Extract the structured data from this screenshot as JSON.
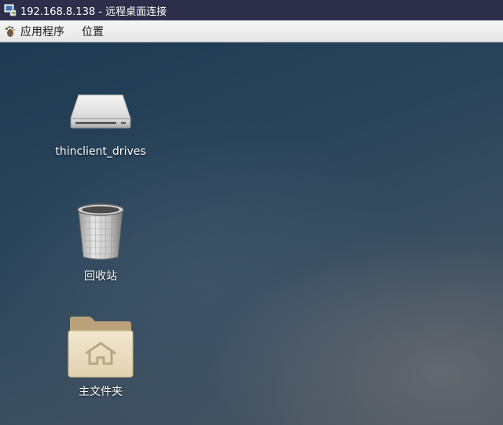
{
  "window": {
    "title": "192.168.8.138 - 远程桌面连接",
    "icon": "remote-desktop-icon"
  },
  "menubar": {
    "applications_label": "应用程序",
    "places_label": "位置",
    "applications_icon": "gnome-foot-icon"
  },
  "desktop": {
    "icons": [
      {
        "label": "thinclient_drives",
        "icon": "drive-icon"
      },
      {
        "label": "回收站",
        "icon": "trash-icon"
      },
      {
        "label": "主文件夹",
        "icon": "home-folder-icon"
      }
    ]
  },
  "colors": {
    "titlebar": "#2c2e4a",
    "menubar": "#f0f0f0",
    "folder": "#e6d9bf"
  }
}
